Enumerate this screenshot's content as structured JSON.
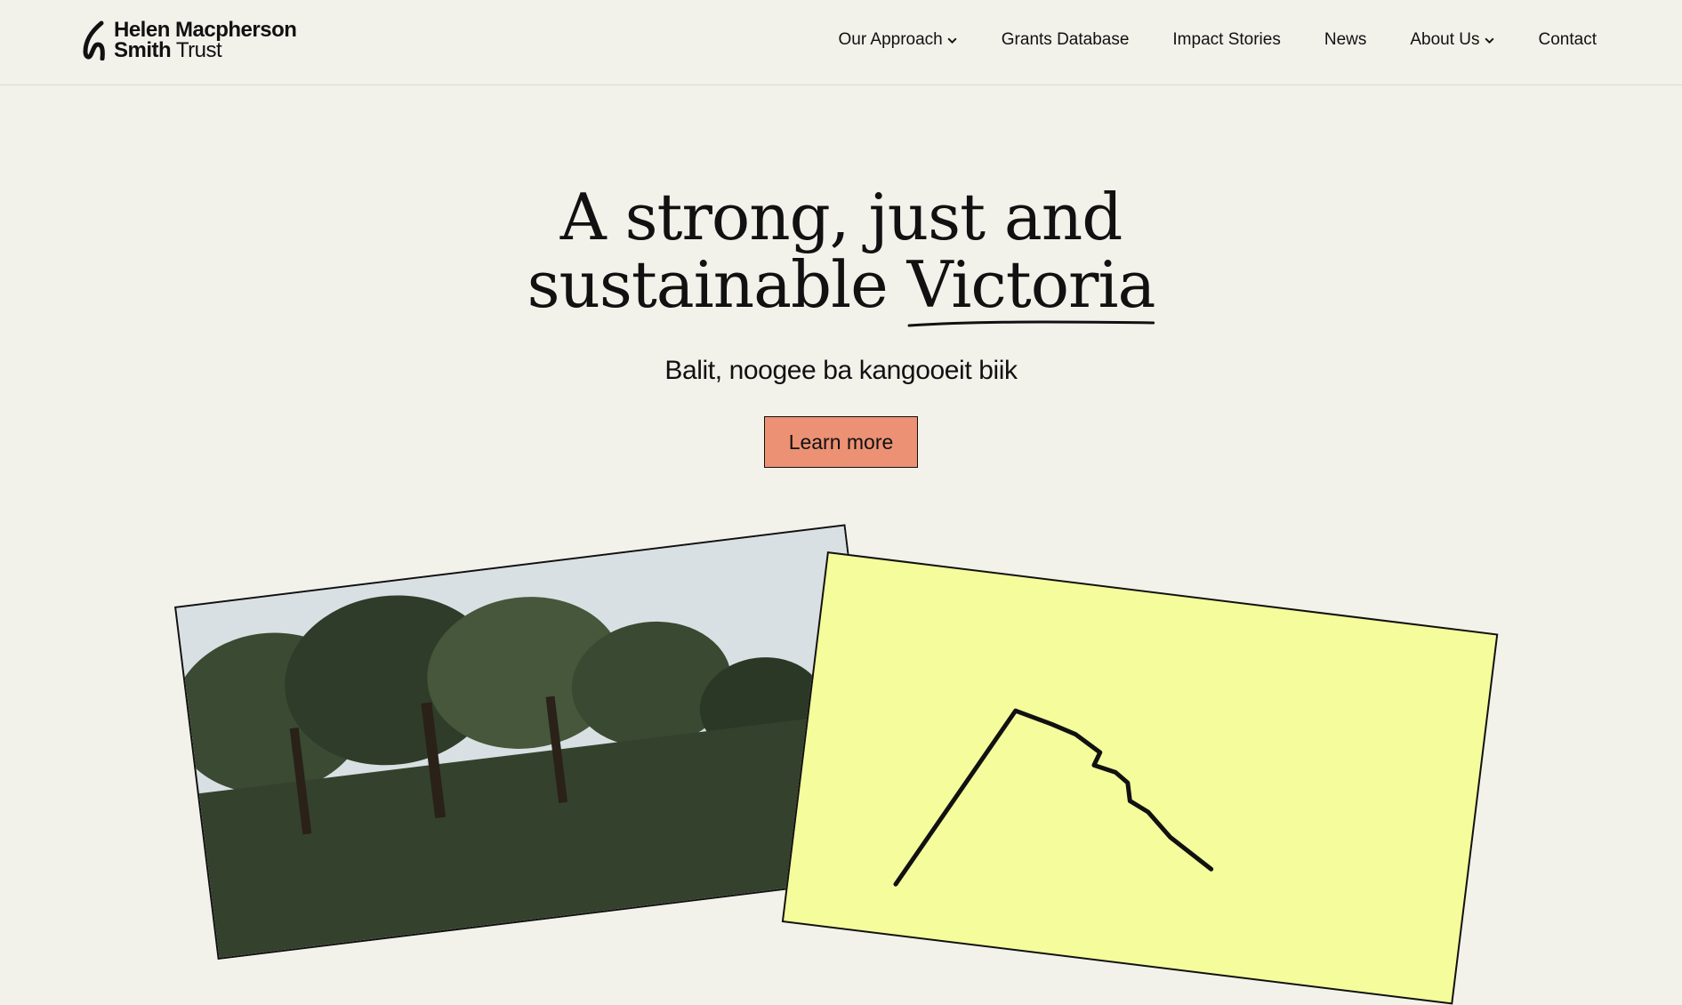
{
  "logo": {
    "line1": "Helen Macpherson",
    "line2_bold": "Smith",
    "line2_regular": " Trust"
  },
  "nav": {
    "items": [
      {
        "label": "Our Approach",
        "has_dropdown": true
      },
      {
        "label": "Grants Database",
        "has_dropdown": false
      },
      {
        "label": "Impact Stories",
        "has_dropdown": false
      },
      {
        "label": "News",
        "has_dropdown": false
      },
      {
        "label": "About Us",
        "has_dropdown": true
      },
      {
        "label": "Contact",
        "has_dropdown": false
      }
    ]
  },
  "hero": {
    "headline_line1": "A strong, just and",
    "headline_line2_plain": "sustainable ",
    "headline_line2_underlined": "Victoria",
    "subheading": "Balit, noogee ba kangooeit biik",
    "cta_label": "Learn more"
  },
  "colors": {
    "background": "#f2f1ea",
    "cta": "#ec9174",
    "map_card": "#f4fc9c"
  }
}
